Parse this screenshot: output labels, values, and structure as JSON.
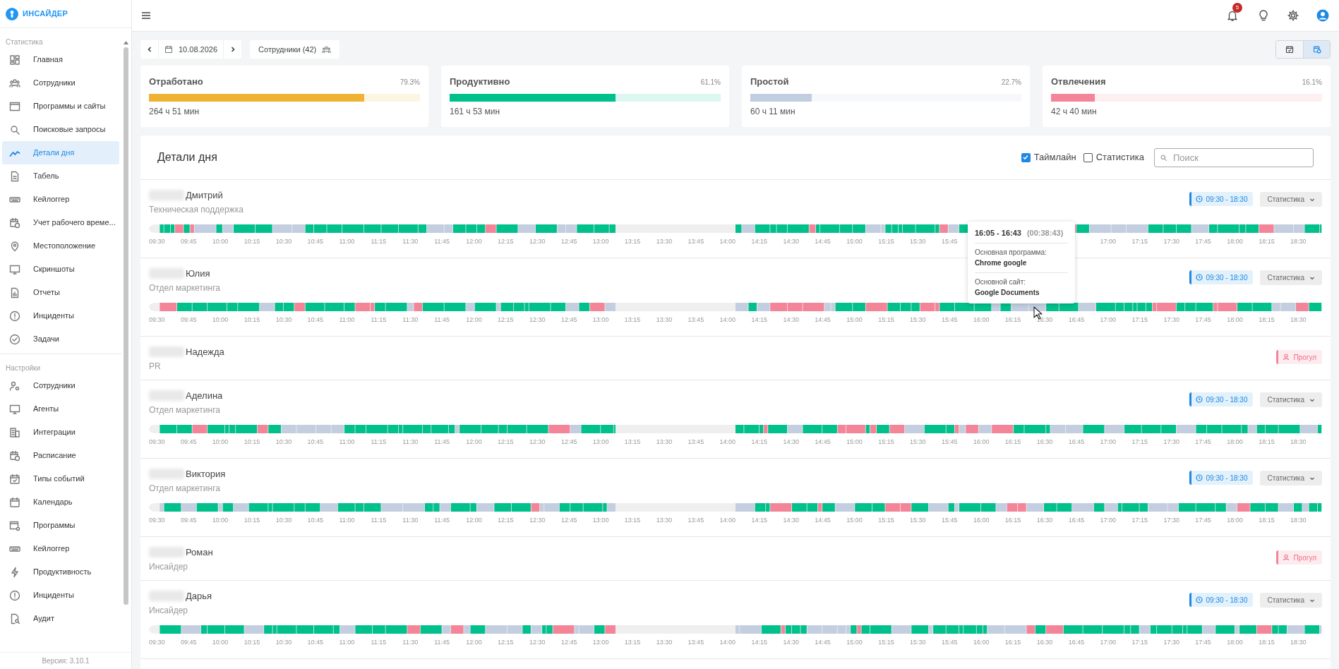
{
  "sidebar": {
    "logo": "ИНСАЙДЕР",
    "sections": [
      {
        "title": "Статистика",
        "items": [
          {
            "label": "Главная",
            "selected": false
          },
          {
            "label": "Сотрудники",
            "selected": false
          },
          {
            "label": "Программы и сайты",
            "selected": false
          },
          {
            "label": "Поисковые запросы",
            "selected": false
          },
          {
            "label": "Детали дня",
            "selected": true
          },
          {
            "label": "Табель",
            "selected": false
          },
          {
            "label": "Кейлоггер",
            "selected": false
          },
          {
            "label": "Учет рабочего време...",
            "selected": false
          },
          {
            "label": "Местоположение",
            "selected": false
          },
          {
            "label": "Скриншоты",
            "selected": false
          },
          {
            "label": "Отчеты",
            "selected": false
          },
          {
            "label": "Инциденты",
            "selected": false
          },
          {
            "label": "Задачи",
            "selected": false
          }
        ]
      },
      {
        "title": "Настройки",
        "items": [
          {
            "label": "Сотрудники",
            "selected": false
          },
          {
            "label": "Агенты",
            "selected": false
          },
          {
            "label": "Интеграции",
            "selected": false
          },
          {
            "label": "Расписание",
            "selected": false
          },
          {
            "label": "Типы событий",
            "selected": false
          },
          {
            "label": "Календарь",
            "selected": false
          },
          {
            "label": "Программы",
            "selected": false
          },
          {
            "label": "Кейлоггер",
            "selected": false
          },
          {
            "label": "Продуктивность",
            "selected": false
          },
          {
            "label": "Инциденты",
            "selected": false
          },
          {
            "label": "Аудит",
            "selected": false
          }
        ]
      }
    ],
    "version": "Версия: 3.10.1"
  },
  "top_bar": {
    "notifications": "5"
  },
  "toolbar": {
    "date": "10.08.2026",
    "employees": "Сотрудники (42)",
    "view_toggle": [
      {
        "selected": false
      },
      {
        "selected": true
      }
    ]
  },
  "stats": [
    {
      "title": "Отработано",
      "percent": "79.3%",
      "value": "264 ч 51 мин",
      "level": 0.793,
      "color": "#f0b232"
    },
    {
      "title": "Продуктивно",
      "percent": "61.1%",
      "value": "161 ч 53 мин",
      "level": 0.611,
      "color": "#00c08b"
    },
    {
      "title": "Простой",
      "percent": "22.7%",
      "value": "60 ч 11 мин",
      "level": 0.227,
      "color": "#c1cde0"
    },
    {
      "title": "Отвлечения",
      "percent": "16.1%",
      "value": "42 ч 40 мин",
      "level": 0.161,
      "color": "#f48599"
    }
  ],
  "details": {
    "title": "Детали дня",
    "filters": [
      {
        "label": "Таймлайн",
        "checked": true
      },
      {
        "label": "Статистика",
        "checked": false
      }
    ],
    "search": {
      "placeholder": "Поиск"
    },
    "rows": [
      {
        "kind": "timeline",
        "name": "Дмитрий",
        "department": "Техническая поддержка",
        "schedule": "09:30 - 18:30",
        "menu": "Статистика",
        "ticks": [
          [
            "09:30",
            "09:45",
            "10:00",
            "10:15",
            "10:30",
            "10:45",
            "11:00",
            "11:15",
            "11:30",
            "11:45",
            "12:00",
            "12:15",
            "12:30",
            "12:45",
            "13:00",
            "13:15",
            "13:30",
            "13:45",
            "14:00",
            "14:15",
            "14:30",
            "14:45",
            "15:00",
            "15:15",
            "15:30",
            "15:45"
          ],
          [
            "17:00",
            "17:15",
            "17:30",
            "17:45",
            "18:00",
            "18:15",
            "18:30"
          ]
        ],
        "tooltip": {
          "range": "16:05 - 16:43",
          "duration": "(00:38:43)",
          "program_label": "Основная программа:",
          "program": "Chrome google",
          "site_label": "Основной сайт:",
          "site": "Google Documents"
        }
      },
      {
        "kind": "timeline",
        "name": "Юлия",
        "department": "Отдел маркетинга",
        "schedule": "09:30 - 18:30",
        "menu": "Статистика",
        "ticks": [
          [
            "09:30",
            "09:45",
            "10:00",
            "10:15",
            "10:30",
            "10:45",
            "11:00",
            "11:15",
            "11:30",
            "11:45",
            "12:00",
            "12:15",
            "12:30",
            "12:45",
            "13:00",
            "13:15",
            "13:30",
            "13:45",
            "14:00",
            "14:15",
            "14:30",
            "14:45",
            "15:00",
            "15:15",
            "15:30",
            "15:45",
            "16:00",
            "16:15",
            "16:30",
            "16:45",
            "17:00",
            "17:15",
            "17:30",
            "17:45",
            "18:00",
            "18:15",
            "18:30"
          ]
        ]
      },
      {
        "kind": "absent",
        "name": "Надежда",
        "department": "PR",
        "badge": "Прогул"
      },
      {
        "kind": "timeline",
        "name": "Аделина",
        "department": "Отдел маркетинга",
        "schedule": "09:30 - 18:30",
        "menu": "Статистика",
        "ticks": [
          [
            "09:30",
            "09:45",
            "10:00",
            "10:15",
            "10:30",
            "10:45",
            "11:00",
            "11:15",
            "11:30",
            "11:45",
            "12:00",
            "12:15",
            "12:30",
            "12:45",
            "13:00",
            "13:15",
            "13:30",
            "13:45",
            "14:00",
            "14:15",
            "14:30",
            "14:45",
            "15:00",
            "15:15",
            "15:30",
            "15:45",
            "16:00",
            "16:15",
            "16:30",
            "16:45",
            "17:00",
            "17:15",
            "17:30",
            "17:45",
            "18:00",
            "18:15",
            "18:30"
          ]
        ]
      },
      {
        "kind": "timeline",
        "name": "Виктория",
        "department": "Отдел маркетинга",
        "schedule": "09:30 - 18:30",
        "menu": "Статистика",
        "ticks": [
          [
            "09:30",
            "09:45",
            "10:00",
            "10:15",
            "10:30",
            "10:45",
            "11:00",
            "11:15",
            "11:30",
            "11:45",
            "12:00",
            "12:15",
            "12:30",
            "12:45",
            "13:00",
            "13:15",
            "13:30",
            "13:45",
            "14:00",
            "14:15",
            "14:30",
            "14:45",
            "15:00",
            "15:15",
            "15:30",
            "15:45",
            "16:00",
            "16:15",
            "16:30",
            "16:45",
            "17:00",
            "17:15",
            "17:30",
            "17:45",
            "18:00",
            "18:15",
            "18:30"
          ]
        ]
      },
      {
        "kind": "absent",
        "name": "Роман",
        "department": "Инсайдер",
        "badge": "Прогул"
      },
      {
        "kind": "timeline",
        "name": "Дарья",
        "department": "Инсайдер",
        "schedule": "09:30 - 18:30",
        "menu": "Статистика",
        "ticks": [
          [
            "09:30",
            "09:45",
            "10:00",
            "10:15",
            "10:30",
            "10:45",
            "11:00",
            "11:15",
            "11:30",
            "11:45",
            "12:00",
            "12:15",
            "12:30",
            "12:45",
            "13:00",
            "13:15",
            "13:30",
            "13:45",
            "14:00",
            "14:15",
            "14:30",
            "14:45",
            "15:00",
            "15:15",
            "15:30",
            "15:45",
            "16:00",
            "16:15",
            "16:30",
            "16:45",
            "17:00",
            "17:15",
            "17:30",
            "17:45",
            "18:00",
            "18:15",
            "18:30"
          ]
        ]
      }
    ]
  }
}
